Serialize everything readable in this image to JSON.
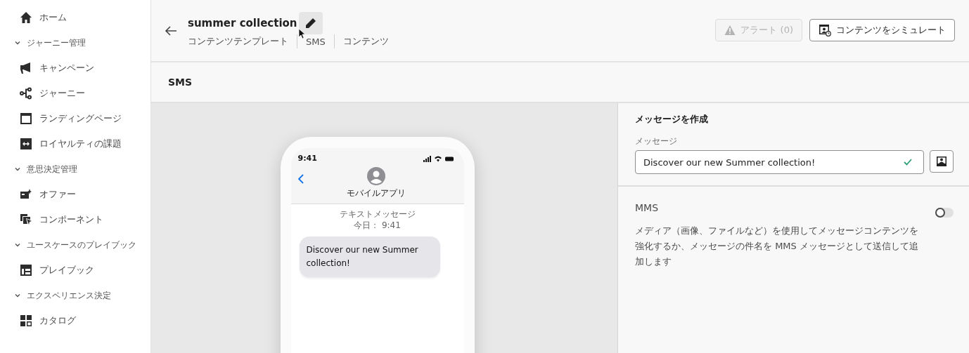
{
  "sidebar": {
    "home": {
      "label": "ホーム"
    },
    "sections": [
      {
        "label": "ジャーニー管理",
        "expanded": true,
        "items": [
          {
            "label": "キャンペーン"
          },
          {
            "label": "ジャーニー"
          },
          {
            "label": "ランディングページ"
          },
          {
            "label": "ロイヤルティの課題"
          }
        ]
      },
      {
        "label": "意思決定管理",
        "expanded": true,
        "items": [
          {
            "label": "オファー"
          },
          {
            "label": "コンポーネント"
          }
        ]
      },
      {
        "label": "ユースケースのプレイブック",
        "expanded": true,
        "items": [
          {
            "label": "プレイブック"
          }
        ]
      },
      {
        "label": "エクスペリエンス決定",
        "expanded": true,
        "items": [
          {
            "label": "カタログ"
          }
        ]
      }
    ]
  },
  "header": {
    "title": "summer collection",
    "breadcrumbs": [
      "コンテンツテンプレート",
      "SMS",
      "コンテンツ"
    ],
    "buttons": [
      {
        "label": "アラート (0)",
        "kind": "alert",
        "disabled": true
      },
      {
        "label": "コンテンツをシミュレート",
        "kind": "simulate",
        "disabled": false
      }
    ]
  },
  "channel_bar": {
    "title": "SMS"
  },
  "phone": {
    "time": "9:41",
    "contact": "モバイルアプリ",
    "thread_label": "テキストメッセージ",
    "thread_time": "今日： 9:41",
    "bubble": "Discover our new Summer collection!"
  },
  "message_panel": {
    "title": "メッセージを作成",
    "field_label": "メッセージ",
    "field_value": "Discover our new Summer collection!",
    "valid": true
  },
  "mms": {
    "title": "MMS",
    "on": false,
    "description": "メディア（画像、ファイルなど）を使用してメッセージコンテンツを強化するか、メッセージの件名を MMS メッセージとして送信して追加します"
  }
}
